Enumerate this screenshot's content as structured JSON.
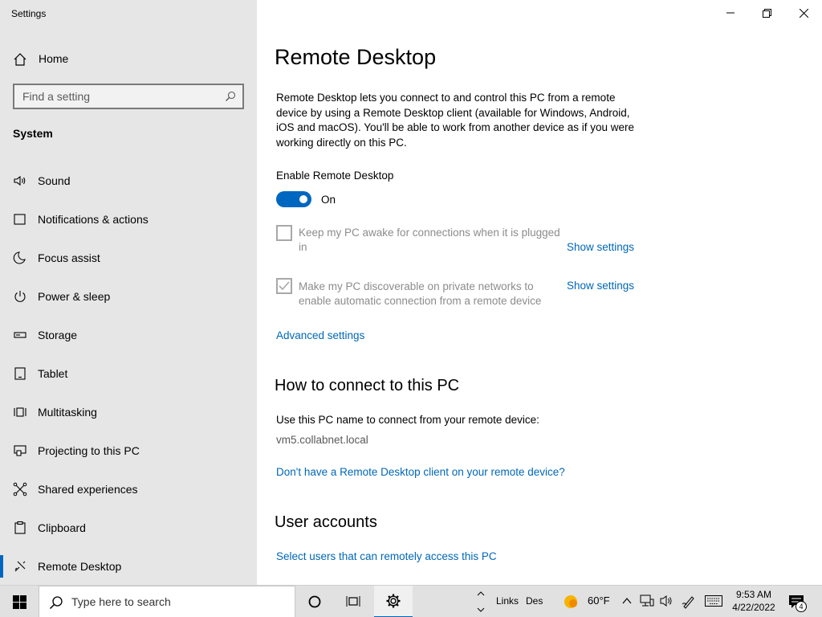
{
  "window": {
    "title": "Settings"
  },
  "sidebar": {
    "home_label": "Home",
    "search_placeholder": "Find a setting",
    "section_title": "System",
    "items": [
      {
        "label": "Sound",
        "icon": "speaker-icon"
      },
      {
        "label": "Notifications & actions",
        "icon": "notifications-icon"
      },
      {
        "label": "Focus assist",
        "icon": "moon-icon"
      },
      {
        "label": "Power & sleep",
        "icon": "power-icon"
      },
      {
        "label": "Storage",
        "icon": "storage-icon"
      },
      {
        "label": "Tablet",
        "icon": "tablet-icon"
      },
      {
        "label": "Multitasking",
        "icon": "multitasking-icon"
      },
      {
        "label": "Projecting to this PC",
        "icon": "projecting-icon"
      },
      {
        "label": "Shared experiences",
        "icon": "shared-icon"
      },
      {
        "label": "Clipboard",
        "icon": "clipboard-icon"
      },
      {
        "label": "Remote Desktop",
        "icon": "remote-desktop-icon",
        "active": true
      }
    ]
  },
  "main": {
    "title": "Remote Desktop",
    "description": "Remote Desktop lets you connect to and control this PC from a remote device by using a Remote Desktop client (available for Windows, Android, iOS and macOS). You'll be able to work from another device as if you were working directly on this PC.",
    "enable_label": "Enable Remote Desktop",
    "toggle_state": "On",
    "toggle_on": true,
    "keep_awake": {
      "text": "Keep my PC awake for connections when it is plugged in",
      "checked": false,
      "link": "Show settings"
    },
    "discoverable": {
      "text": "Make my PC discoverable on private networks to enable automatic connection from a remote device",
      "checked": true,
      "link": "Show settings"
    },
    "advanced_link": "Advanced settings",
    "connect_heading": "How to connect to this PC",
    "connect_text": "Use this PC name to connect from your remote device:",
    "pc_name": "vm5.collabnet.local",
    "client_link": "Don't have a Remote Desktop client on your remote device?",
    "accounts_heading": "User accounts",
    "accounts_link": "Select users that can remotely access this PC"
  },
  "taskbar": {
    "search_placeholder": "Type here to search",
    "links_label": "Links",
    "des_label": "Des",
    "weather": "60°F",
    "time": "9:53 AM",
    "date": "4/22/2022",
    "notification_count": "4"
  },
  "colors": {
    "accent": "#0067c0",
    "link": "#0067b8",
    "sidebar_bg": "#e6e6e6",
    "taskbar_bg": "#e1e1e1"
  }
}
